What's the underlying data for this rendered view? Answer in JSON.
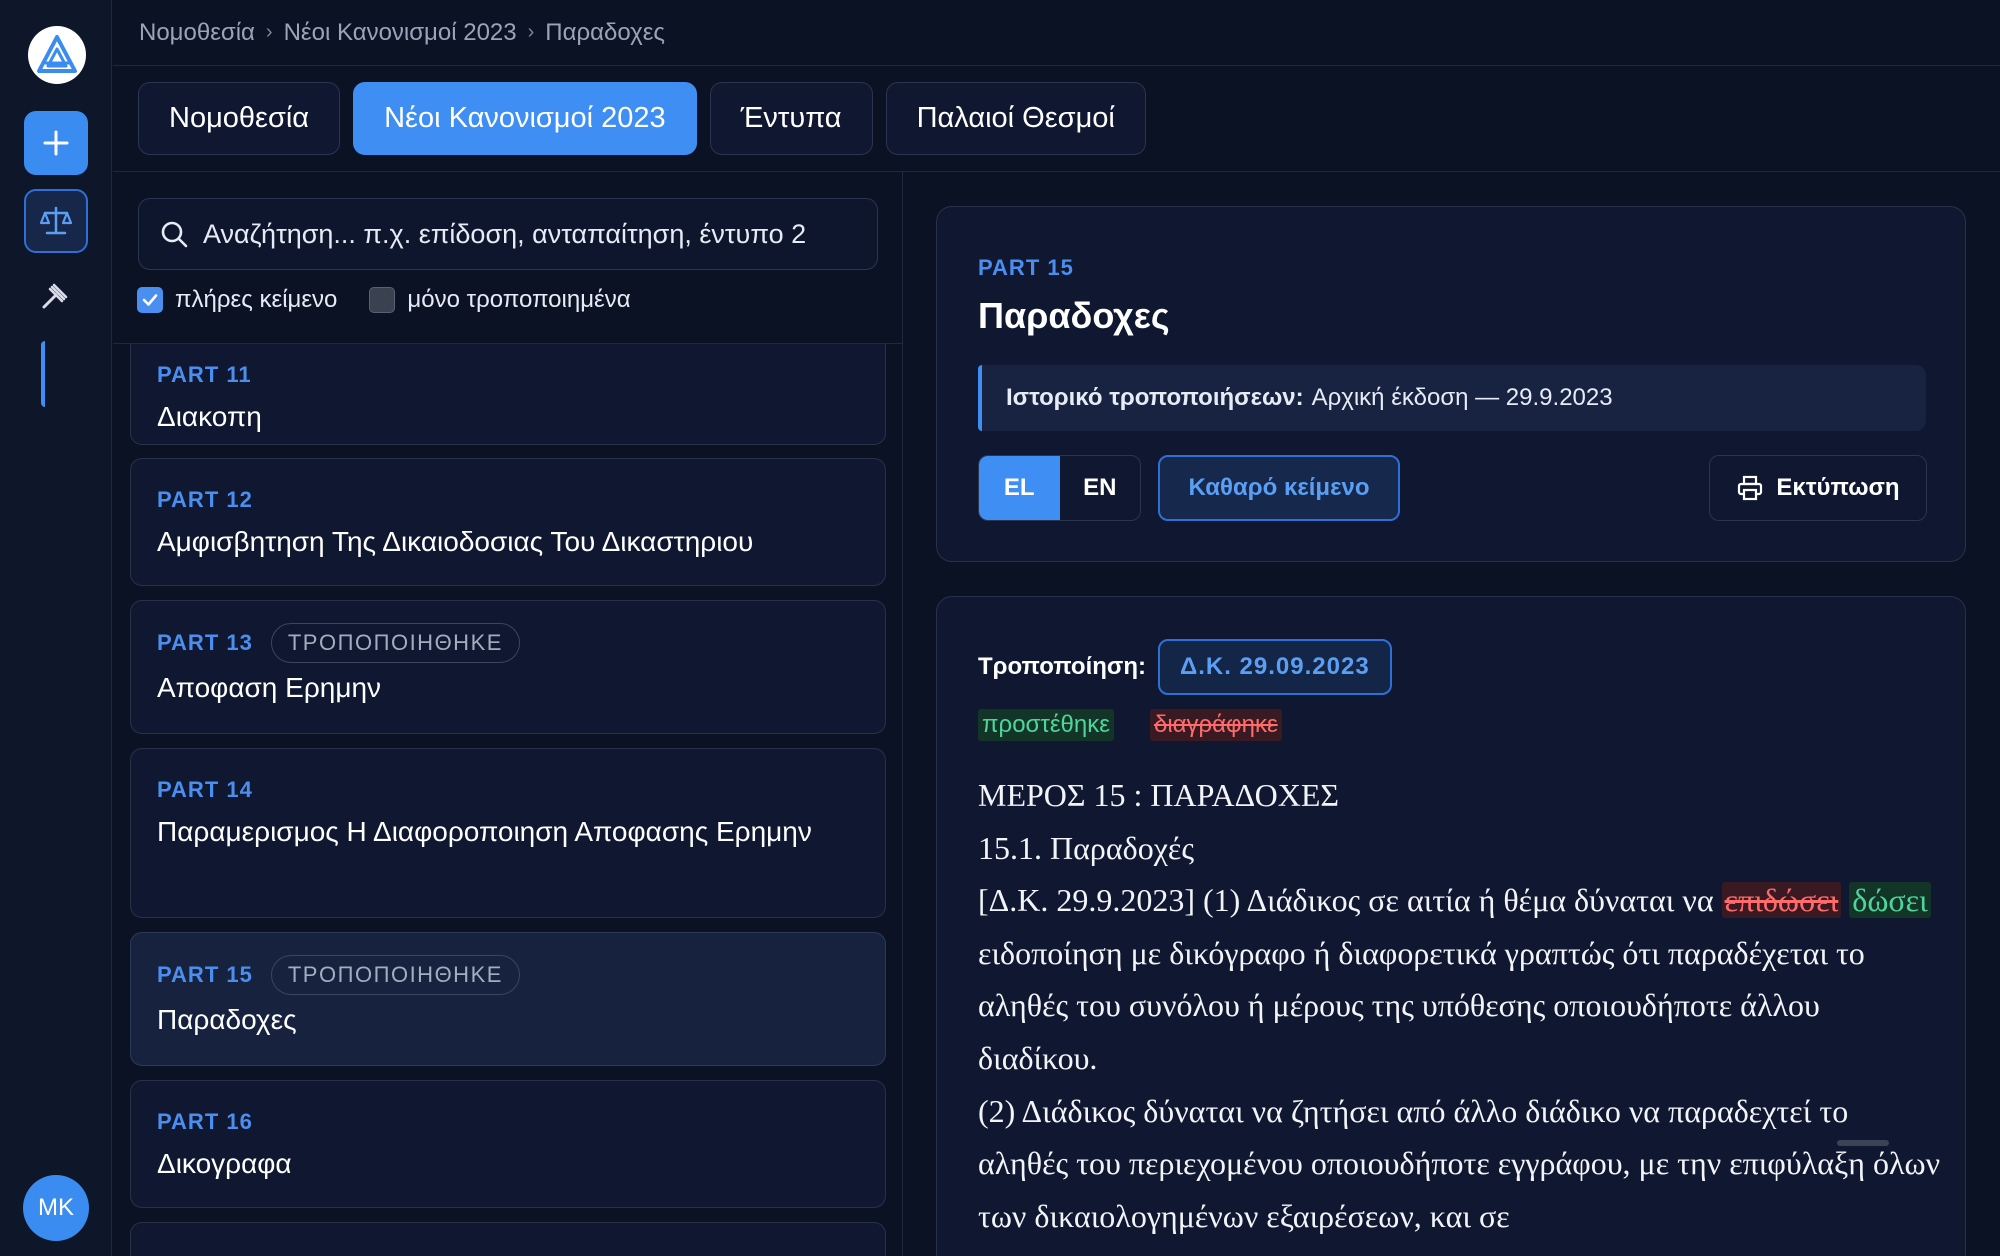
{
  "breadcrumb": [
    "Νομοθεσία",
    "Νέοι Κανονισμοί 2023",
    "Παραδοχες"
  ],
  "breadcrumb_separator": "›",
  "tabs": [
    {
      "label": "Νομοθεσία",
      "active": false
    },
    {
      "label": "Νέοι Κανονισμοί 2023",
      "active": true
    },
    {
      "label": "Έντυπα",
      "active": false
    },
    {
      "label": "Παλαιοί Θεσμοί",
      "active": false
    }
  ],
  "sidebar": {
    "icons": [
      "logo-icon",
      "plus-icon",
      "scales-icon",
      "gavel-icon",
      "history-icon"
    ],
    "avatar_initials": "MK"
  },
  "search": {
    "placeholder": "Αναζήτηση... π.χ. επίδοση, ανταπαίτηση, έντυπο 2"
  },
  "filters": [
    {
      "label": "πλήρες κείμενο",
      "checked": true
    },
    {
      "label": "μόνο τροποποιημένα",
      "checked": false
    }
  ],
  "parts": [
    {
      "label": "PART 11",
      "title": "Διακοπη",
      "badge": ""
    },
    {
      "label": "PART 12",
      "title": "Αμφισβητηση Της Δικαιοδοσιας Του Δικαστηριου",
      "badge": ""
    },
    {
      "label": "PART 13",
      "title": "Αποφαση Ερημην",
      "badge": "ΤΡΟΠΟΠΟΙΗΘΗΚΕ"
    },
    {
      "label": "PART 14",
      "title": "Παραμερισμος Η Διαφοροποιηση Αποφασης Ερημην",
      "badge": ""
    },
    {
      "label": "PART 15",
      "title": "Παραδοχες",
      "badge": "ΤΡΟΠΟΠΟΙΗΘΗΚΕ",
      "selected": true
    },
    {
      "label": "PART 16",
      "title": "Δικογραφα",
      "badge": ""
    }
  ],
  "detail": {
    "part_label": "PART 15",
    "title": "Παραδοχες",
    "history_label": "Ιστορικό τροποποιήσεων:",
    "history_value": "Αρχική έκδοση — 29.9.2023",
    "lang_el": "EL",
    "lang_en": "EN",
    "clean_text_button": "Καθαρό κείμενο",
    "print_button": "Εκτύπωση"
  },
  "content": {
    "amend_label": "Τροποποίηση:",
    "amend_tag": "Δ.Κ. 29.09.2023",
    "legend_added": "προστέθηκε",
    "legend_deleted": "διαγράφηκε",
    "heading": "ΜΕΡΟΣ 15 : ΠΑΡΑΔΟΧΕΣ",
    "subheading": "15.1. Παραδοχές",
    "p1_start": "[Δ.Κ. 29.9.2023] (1) Διάδικος σε αιτία ή θέμα δύναται να",
    "p1_deleted": "επιδώσει",
    "p1_added": "δώσει",
    "p1_rest": "ειδοποίηση με δικόγραφο ή διαφορετικά γραπτώς ότι παραδέχεται το αληθές του συνόλου ή μέρους της υπόθεσης οποιουδήποτε άλλου διαδίκου.",
    "p2": "(2) Διάδικος δύναται να ζητήσει από άλλο διάδικο να παραδεχτεί το αληθές του περιεχομένου οποιουδήποτε εγγράφου, με την επιφύλαξη όλων των δικαιολογημένων εξαιρέσεων, και σε"
  },
  "colors": {
    "accent": "#3f8ef3",
    "background": "#0b1224",
    "added": "#4fd59a",
    "deleted": "#ff6b6b"
  }
}
